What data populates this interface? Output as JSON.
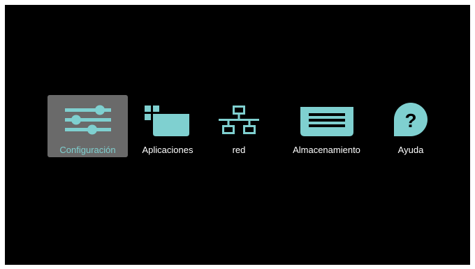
{
  "colors": {
    "background": "#000000",
    "frame": "#ffffff",
    "accent": "#7fd0d0",
    "selected_bg": "#6a6a6a",
    "label": "#ffffff"
  },
  "menu": {
    "selected_index": 0,
    "items": [
      {
        "id": "settings",
        "icon": "sliders-icon",
        "label": "Configuración"
      },
      {
        "id": "apps",
        "icon": "apps-folder-icon",
        "label": "Aplicaciones"
      },
      {
        "id": "network",
        "icon": "network-icon",
        "label": "red"
      },
      {
        "id": "storage",
        "icon": "storage-icon",
        "label": "Almacenamiento"
      },
      {
        "id": "help",
        "icon": "help-icon",
        "label": "Ayuda"
      }
    ]
  }
}
